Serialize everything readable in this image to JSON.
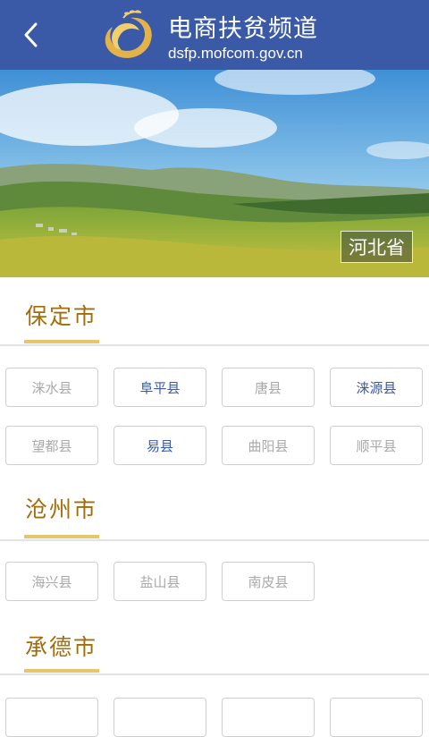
{
  "header": {
    "title": "电商扶贫频道",
    "url": "dsfp.mofcom.gov.cn",
    "brand_color": "#3a5aa8"
  },
  "banner": {
    "province": "河北省"
  },
  "cities": [
    {
      "name": "保定市",
      "counties": [
        {
          "label": "涞水县",
          "active": false
        },
        {
          "label": "阜平县",
          "active": true
        },
        {
          "label": "唐县",
          "active": false
        },
        {
          "label": "涞源县",
          "active": true
        },
        {
          "label": "望都县",
          "active": false
        },
        {
          "label": "易县",
          "active": true
        },
        {
          "label": "曲阳县",
          "active": false
        },
        {
          "label": "顺平县",
          "active": false
        }
      ]
    },
    {
      "name": "沧州市",
      "counties": [
        {
          "label": "海兴县",
          "active": false
        },
        {
          "label": "盐山县",
          "active": false
        },
        {
          "label": "南皮县",
          "active": false
        }
      ]
    },
    {
      "name": "承德市",
      "counties": [
        {
          "label": "",
          "active": true
        },
        {
          "label": "",
          "active": true
        },
        {
          "label": "",
          "active": false
        },
        {
          "label": "",
          "active": false
        }
      ]
    }
  ],
  "colors": {
    "city_title": "#a36d0c",
    "underline": "#e8c56a",
    "active_county": "#3a5aa8",
    "inactive_county": "#a9a9a9"
  }
}
